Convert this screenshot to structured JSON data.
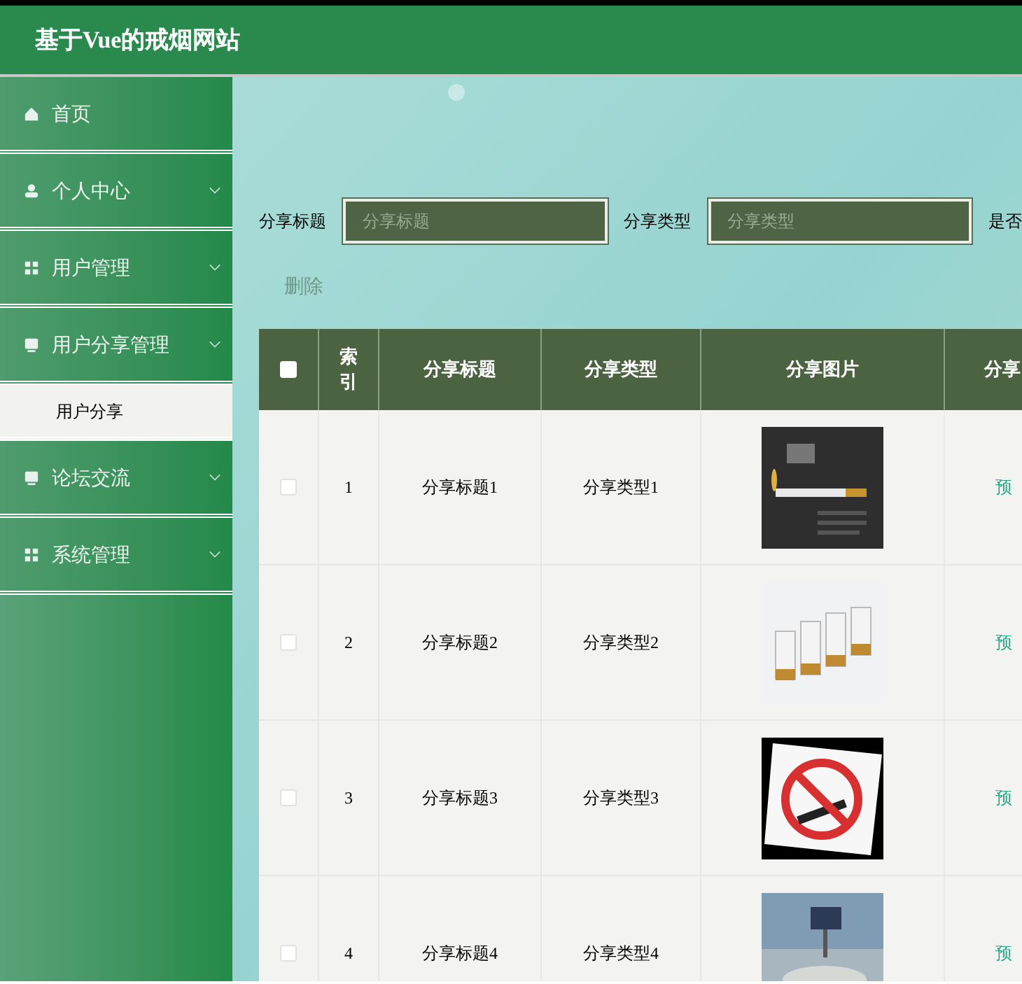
{
  "header": {
    "title": "基于Vue的戒烟网站"
  },
  "sidebar": {
    "items": [
      {
        "label": "首页",
        "expandable": false
      },
      {
        "label": "个人中心",
        "expandable": true
      },
      {
        "label": "用户管理",
        "expandable": true
      },
      {
        "label": "用户分享管理",
        "expandable": true,
        "children": [
          {
            "label": "用户分享"
          }
        ]
      },
      {
        "label": "论坛交流",
        "expandable": true
      },
      {
        "label": "系统管理",
        "expandable": true
      }
    ]
  },
  "search": {
    "fields": [
      {
        "label": "分享标题",
        "placeholder": "分享标题"
      },
      {
        "label": "分享类型",
        "placeholder": "分享类型"
      }
    ],
    "cut_label": "是否"
  },
  "delete_button": "删除",
  "table": {
    "all_checked": false,
    "columns": [
      "索引",
      "分享标题",
      "分享类型",
      "分享图片",
      "分享"
    ],
    "rows": [
      {
        "index": "1",
        "title": "分享标题1",
        "type": "分享类型1",
        "checked": false,
        "action": "预"
      },
      {
        "index": "2",
        "title": "分享标题2",
        "type": "分享类型2",
        "checked": false,
        "action": "预"
      },
      {
        "index": "3",
        "title": "分享标题3",
        "type": "分享类型3",
        "checked": false,
        "action": "预"
      },
      {
        "index": "4",
        "title": "分享标题4",
        "type": "分享类型4",
        "checked": false,
        "action": "预"
      }
    ]
  }
}
